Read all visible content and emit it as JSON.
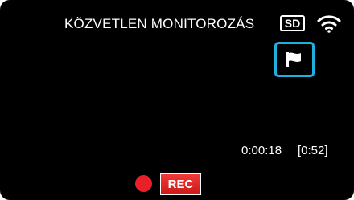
{
  "header": {
    "title": "KÖZVETLEN MONITOROZÁS",
    "storage_badge": "SD",
    "wifi_icon": "wifi-icon"
  },
  "controls": {
    "flag_icon": "flag-icon",
    "rec_label": "REC",
    "rec_dot_icon": "record-dot-icon"
  },
  "status": {
    "elapsed_time": "0:00:18",
    "remaining_time": "[0:52]"
  },
  "colors": {
    "background": "#000000",
    "accent": "#1fb0e0",
    "record": "#e8202a"
  }
}
